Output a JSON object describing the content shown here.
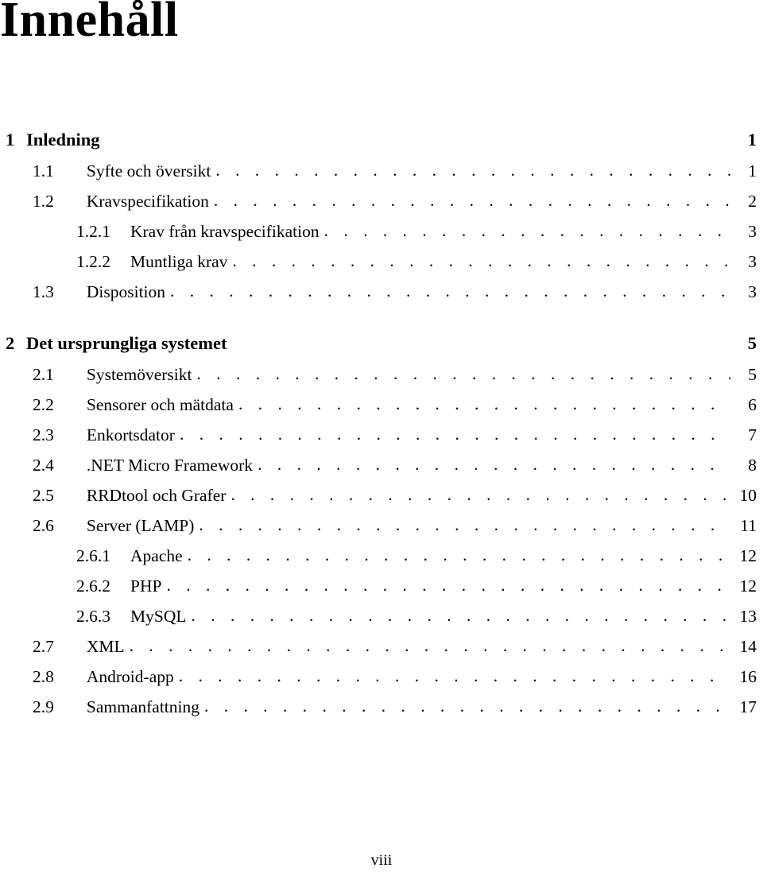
{
  "document": {
    "title": "Innehåll",
    "folio": "viii",
    "leader_char": "."
  },
  "toc": {
    "entries": [
      {
        "level": "chapter",
        "number": "1",
        "label": "Inledning",
        "page": "1",
        "space_above": false
      },
      {
        "level": "section",
        "number": "1.1",
        "label": "Syfte och översikt",
        "page": "1",
        "space_above": false
      },
      {
        "level": "section",
        "number": "1.2",
        "label": "Kravspecifikation",
        "page": "2",
        "space_above": false
      },
      {
        "level": "subsection",
        "number": "1.2.1",
        "label": "Krav från kravspecifikation",
        "page": "3",
        "space_above": false
      },
      {
        "level": "subsection",
        "number": "1.2.2",
        "label": "Muntliga krav",
        "page": "3",
        "space_above": false
      },
      {
        "level": "section",
        "number": "1.3",
        "label": "Disposition",
        "page": "3",
        "space_above": false
      },
      {
        "level": "chapter",
        "number": "2",
        "label": "Det ursprungliga systemet",
        "page": "5",
        "space_above": true
      },
      {
        "level": "section",
        "number": "2.1",
        "label": "Systemöversikt",
        "page": "5",
        "space_above": false
      },
      {
        "level": "section",
        "number": "2.2",
        "label": "Sensorer och mätdata",
        "page": "6",
        "space_above": false
      },
      {
        "level": "section",
        "number": "2.3",
        "label": "Enkortsdator",
        "page": "7",
        "space_above": false
      },
      {
        "level": "section",
        "number": "2.4",
        "label": ".NET Micro Framework",
        "page": "8",
        "space_above": false
      },
      {
        "level": "section",
        "number": "2.5",
        "label": "RRDtool och Grafer",
        "page": "10",
        "space_above": false
      },
      {
        "level": "section",
        "number": "2.6",
        "label": "Server (LAMP)",
        "page": "11",
        "space_above": false
      },
      {
        "level": "subsection",
        "number": "2.6.1",
        "label": "Apache",
        "page": "12",
        "space_above": false
      },
      {
        "level": "subsection",
        "number": "2.6.2",
        "label": "PHP",
        "page": "12",
        "space_above": false
      },
      {
        "level": "subsection",
        "number": "2.6.3",
        "label": "MySQL",
        "page": "13",
        "space_above": false
      },
      {
        "level": "section",
        "number": "2.7",
        "label": "XML",
        "page": "14",
        "space_above": false
      },
      {
        "level": "section",
        "number": "2.8",
        "label": "Android-app",
        "page": "16",
        "space_above": false
      },
      {
        "level": "section",
        "number": "2.9",
        "label": "Sammanfattning",
        "page": "17",
        "space_above": false
      }
    ]
  }
}
